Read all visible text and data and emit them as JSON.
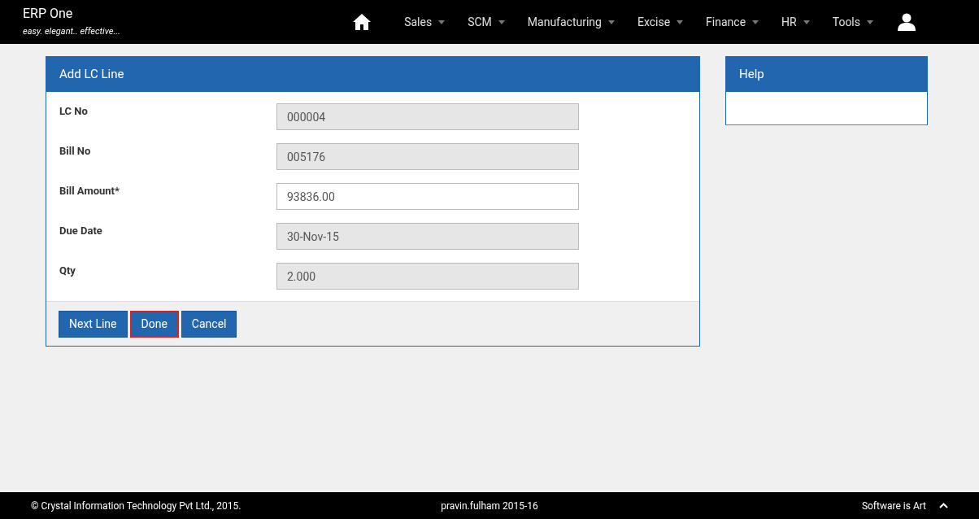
{
  "brand": {
    "title": "ERP One",
    "tagline": "easy. elegant.. effective..."
  },
  "nav": [
    "Sales",
    "SCM",
    "Manufacturing",
    "Excise",
    "Finance",
    "HR",
    "Tools"
  ],
  "form": {
    "title": "Add LC Line",
    "fields": [
      {
        "label": "LC No",
        "value": "000004",
        "disabled": true
      },
      {
        "label": "Bill No",
        "value": "005176",
        "disabled": true
      },
      {
        "label": "Bill Amount*",
        "value": "93836.00",
        "disabled": false
      },
      {
        "label": "Due Date",
        "value": "30-Nov-15",
        "disabled": true
      },
      {
        "label": "Qty",
        "value": "2.000",
        "disabled": true
      }
    ],
    "buttons": [
      {
        "label": "Next Line",
        "focused": false
      },
      {
        "label": "Done",
        "focused": true
      },
      {
        "label": "Cancel",
        "focused": false
      }
    ]
  },
  "help": {
    "title": "Help"
  },
  "footer": {
    "copyright": "© Crystal Information Technology Pvt Ltd., 2015.",
    "user": "pravin.fulham 2015-16",
    "motto": "Software is Art"
  }
}
